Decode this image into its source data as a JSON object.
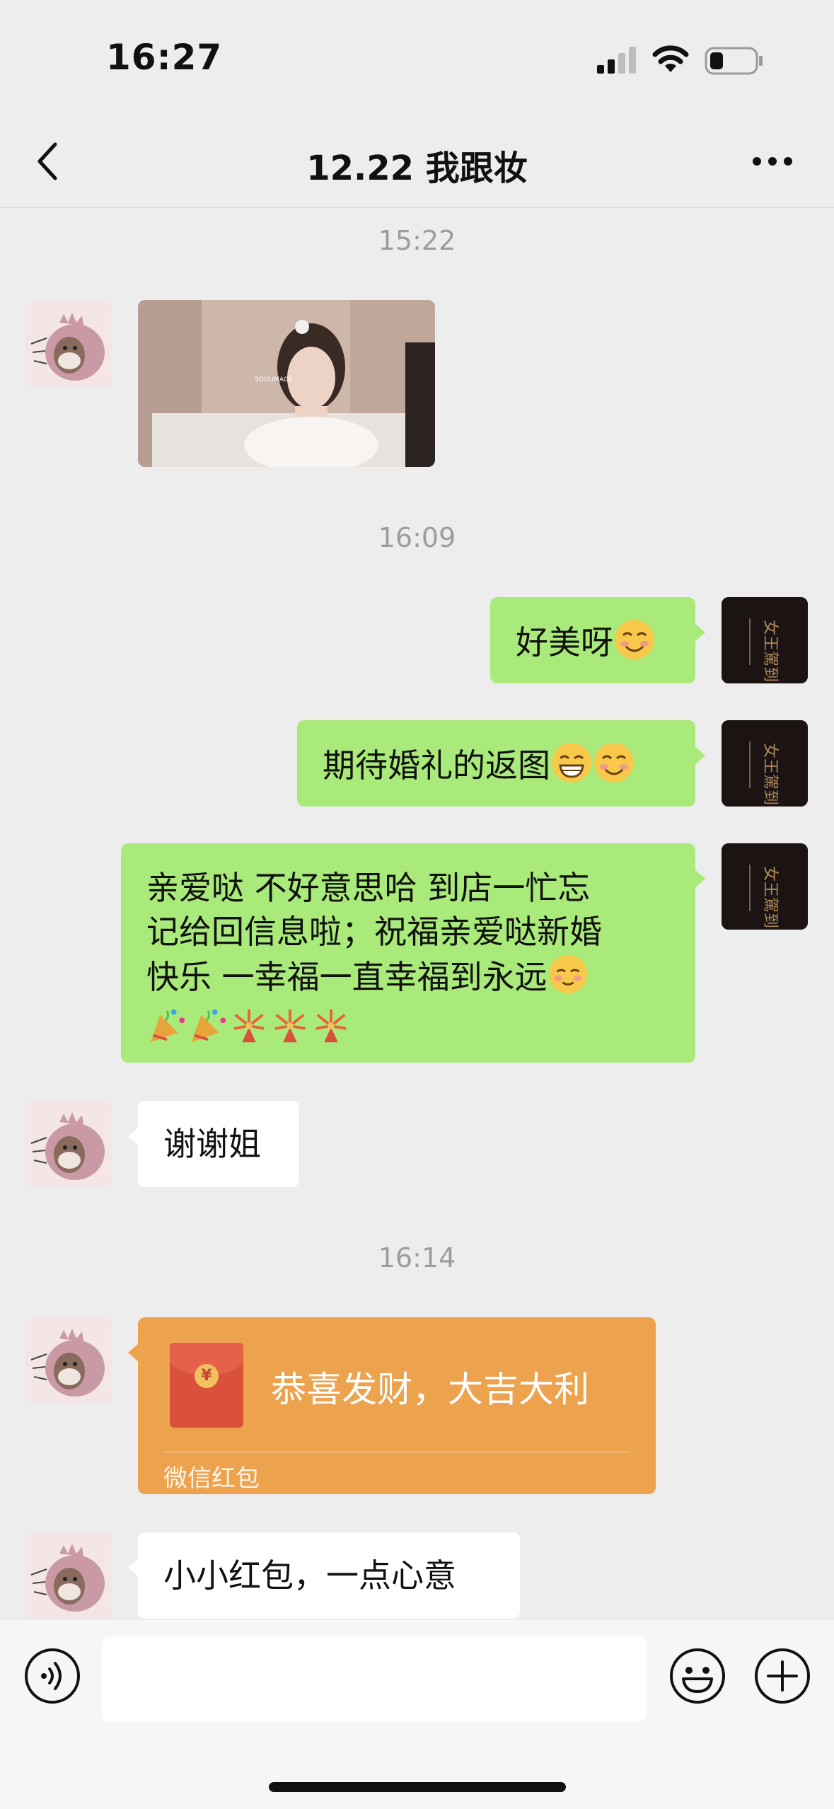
{
  "status_bar": {
    "time": "16:27"
  },
  "nav": {
    "title": "12.22 我跟妆"
  },
  "chat": {
    "timestamps": [
      "15:22",
      "16:09",
      "16:14"
    ],
    "image_watermark": "SOULIMAGE",
    "right_avatar_text": "女王駕到",
    "messages": {
      "m1": {
        "text": "好美呀"
      },
      "m2": {
        "text": "期待婚礼的返图"
      },
      "m3": {
        "line1": "亲爱哒 不好意思哈 到店一忙忘",
        "line2": "记给回信息啦；祝福亲爱哒新婚",
        "line3": "快乐 一幸福一直幸福到永远"
      },
      "m4": {
        "text": "谢谢姐"
      },
      "m5": {
        "text": "小小红包，一点心意"
      }
    },
    "red_packet": {
      "greeting": "恭喜发财，大吉大利",
      "label": "微信红包",
      "symbol": "¥"
    }
  },
  "input": {
    "placeholder": ""
  },
  "colors": {
    "bubble_green": "#a9ea7a",
    "red_packet": "#eda24e",
    "background": "#ededed"
  }
}
